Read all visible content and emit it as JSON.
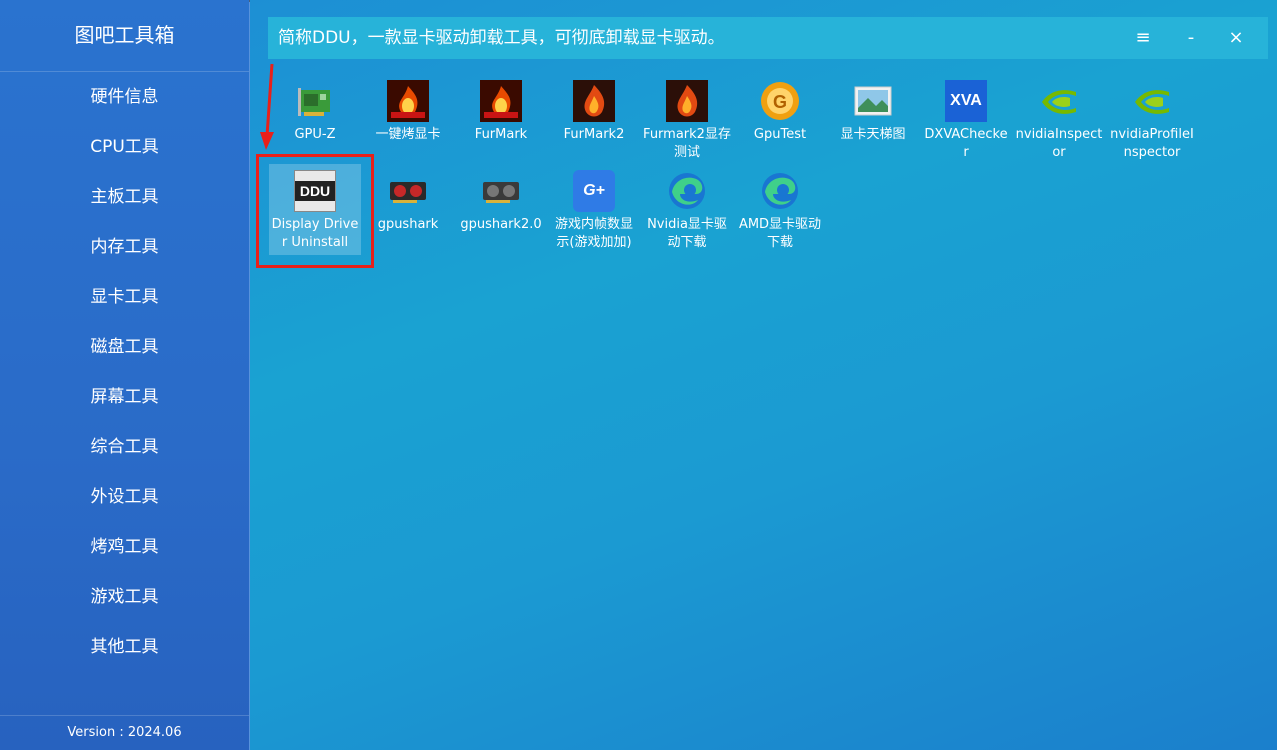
{
  "app": {
    "title": "图吧工具箱",
    "version": "Version : 2024.06"
  },
  "sidebar": {
    "items": [
      {
        "label": "硬件信息"
      },
      {
        "label": "CPU工具"
      },
      {
        "label": "主板工具"
      },
      {
        "label": "内存工具"
      },
      {
        "label": "显卡工具"
      },
      {
        "label": "磁盘工具"
      },
      {
        "label": "屏幕工具"
      },
      {
        "label": "综合工具"
      },
      {
        "label": "外设工具"
      },
      {
        "label": "烤鸡工具"
      },
      {
        "label": "游戏工具"
      },
      {
        "label": "其他工具"
      }
    ]
  },
  "header": {
    "description": "简称DDU，一款显卡驱动卸载工具，可彻底卸载显卡驱动。",
    "menu_glyph": "≡",
    "minimize_glyph": "-",
    "close_glyph": "×"
  },
  "tools": [
    {
      "label": "GPU-Z",
      "icon": "gpu-card-icon"
    },
    {
      "label": "一键烤显卡",
      "icon": "furmark-icon"
    },
    {
      "label": "FurMark",
      "icon": "furmark-icon"
    },
    {
      "label": "FurMark2",
      "icon": "furmark2-icon"
    },
    {
      "label": "Furmark2显存测试",
      "icon": "furmark2-icon"
    },
    {
      "label": "GpuTest",
      "icon": "gputest-icon"
    },
    {
      "label": "显卡天梯图",
      "icon": "image-icon"
    },
    {
      "label": "DXVAChecker",
      "icon": "xva-icon",
      "icon_text": "XVA"
    },
    {
      "label": "nvidiaInspector",
      "icon": "nvidia-icon"
    },
    {
      "label": "nvidiaProfileInspector",
      "icon": "nvidia-icon"
    },
    {
      "label": "Display Driver Uninstall",
      "icon": "ddu-icon",
      "icon_text": "DDU",
      "selected": true
    },
    {
      "label": "gpushark",
      "icon": "graphics-card-icon"
    },
    {
      "label": "gpushark2.0",
      "icon": "graphics-card-icon"
    },
    {
      "label": "游戏内帧数显示(游戏加加)",
      "icon": "game-plus-icon",
      "icon_text": "G+"
    },
    {
      "label": "Nvidia显卡驱动下载",
      "icon": "edge-icon"
    },
    {
      "label": "AMD显卡驱动下载",
      "icon": "edge-icon"
    }
  ],
  "colors": {
    "highlight": "#e8201a",
    "header": "#27b3d9",
    "sidebar": "#2a6bc8"
  }
}
